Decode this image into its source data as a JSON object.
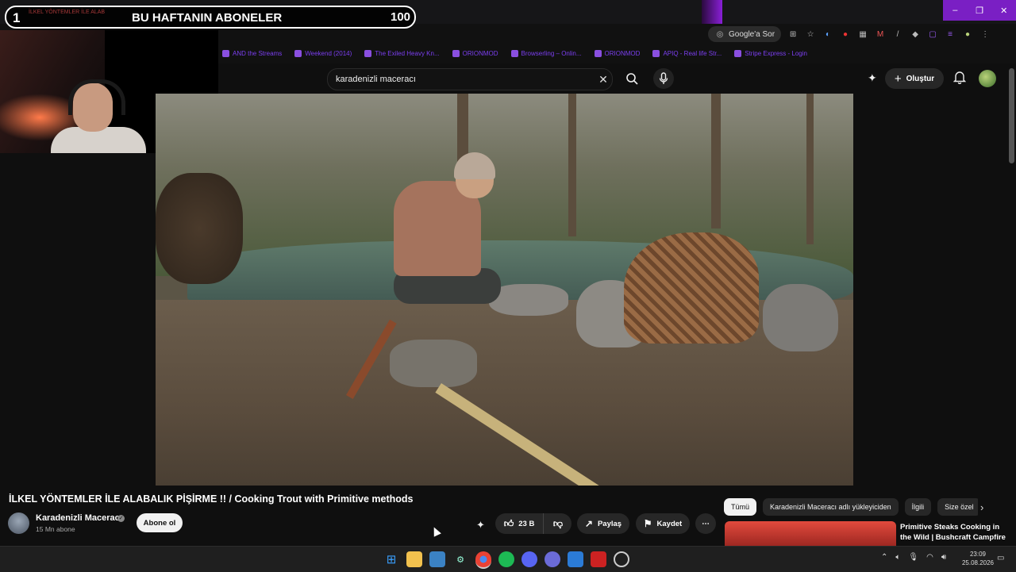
{
  "overlay": {
    "rank": "1",
    "title": "BU HAFTANIN ABONELER",
    "count": "100",
    "subline": "İLKEL YÖNTEMLER İLE ALAB"
  },
  "browser": {
    "google_ask": "Google'a Sor",
    "window_controls": [
      "–",
      "❐",
      "✕"
    ],
    "bookmarks": [
      "AND the Streams",
      "Weekend (2014)",
      "The Exiled Heavy Kn...",
      "ORIONMOD",
      "Browserling – Onlin...",
      "ORIONMOD",
      "APIQ - Real life Str...",
      "Stripe Express - Login"
    ]
  },
  "youtube": {
    "search_query": "karadenizli maceracı",
    "create_label": "Oluştur",
    "video_title": "İLKEL YÖNTEMLER İLE ALABALIK PİŞİRME !! / Cooking Trout with Primitive methods",
    "channel_name": "Karadenizli Maceracı",
    "subscribers": "15 Mn abone",
    "subscribe_label": "Abone ol",
    "likes": "23 B",
    "share_label": "Paylaş",
    "save_label": "Kaydet",
    "chips": [
      "Tümü",
      "Karadenizli Maceracı adlı yükleyiciden",
      "İlgili",
      "Size özel"
    ],
    "recommended_title": "Primitive Steaks Cooking in the Wild | Bushcraft Campfire Steak Compilation"
  },
  "taskbar": {
    "time": "23:09",
    "date": "25.08.2026"
  },
  "colors": {
    "yt_bg": "#0f0f0f",
    "accent_purple": "#7a1fc4",
    "chip_active": "#f1f1f1"
  }
}
